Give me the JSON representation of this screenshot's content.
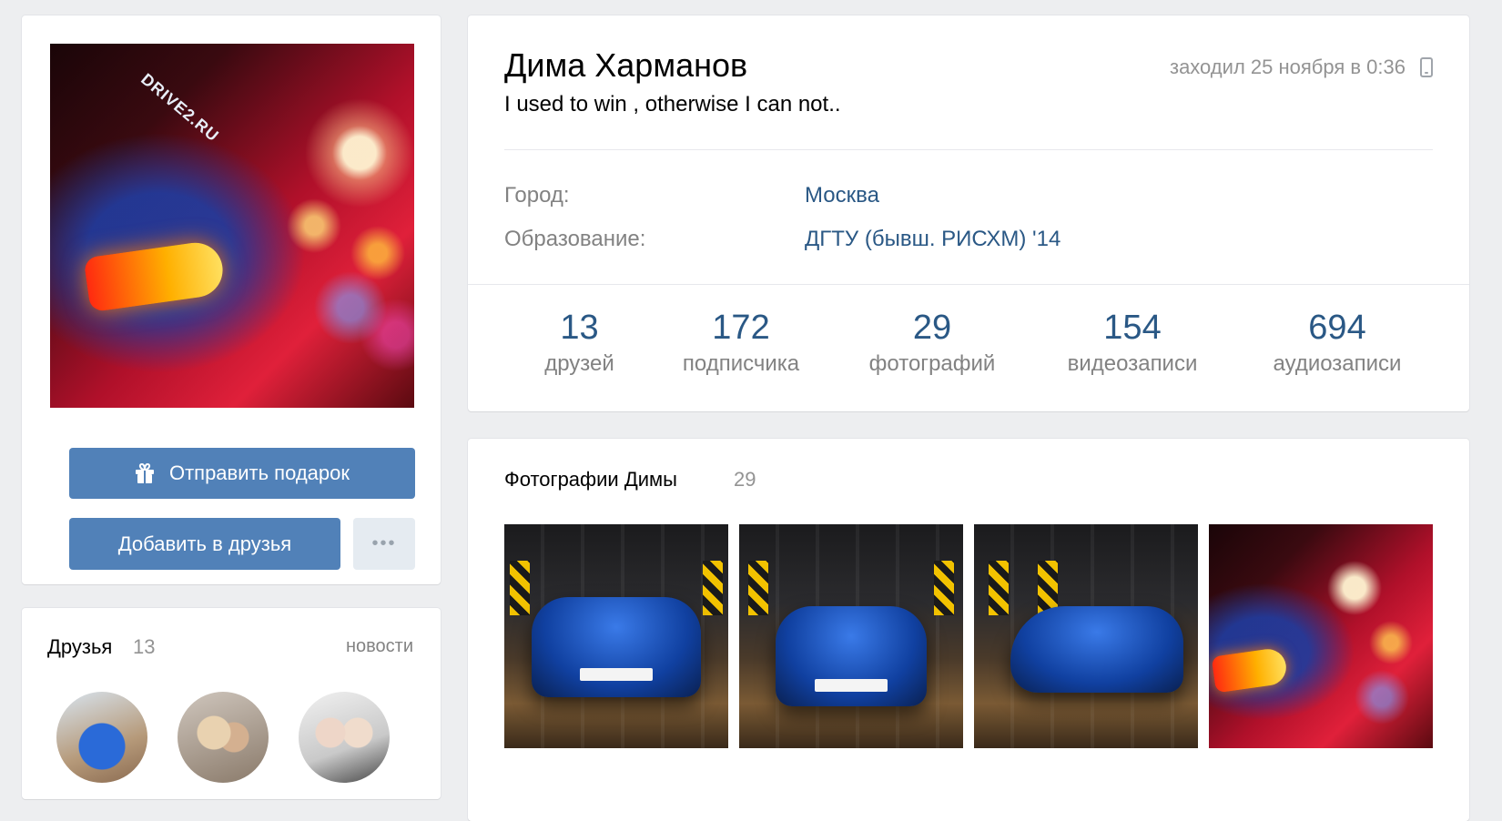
{
  "profile": {
    "name": "Дима Харманов",
    "status": "I used to win , otherwise I can not..",
    "last_seen": "заходил 25 ноября в 0:36",
    "info": {
      "city_label": "Город:",
      "city_value": "Москва",
      "education_label": "Образование:",
      "education_value": "ДГТУ (бывш. РИСХМ) '14"
    },
    "counters": [
      {
        "value": "13",
        "label": "друзей"
      },
      {
        "value": "172",
        "label": "подписчика"
      },
      {
        "value": "29",
        "label": "фотографий"
      },
      {
        "value": "154",
        "label": "видеозаписи"
      },
      {
        "value": "694",
        "label": "аудиозаписи"
      }
    ]
  },
  "avatar": {
    "sticker_text": "DRIVE2.RU"
  },
  "actions": {
    "gift_label": "Отправить подарок",
    "add_friend_label": "Добавить в друзья",
    "more_label": "•••"
  },
  "friends": {
    "title": "Друзья",
    "count": "13",
    "news_label": "новости"
  },
  "photos": {
    "title": "Фотографии Димы",
    "count": "29"
  },
  "icons": {
    "gift": "gift-icon",
    "phone": "mobile-phone-icon",
    "more": "more-dots-icon"
  },
  "colors": {
    "accent": "#5181b8",
    "link": "#2a5885",
    "muted": "#828282",
    "background": "#edeef0"
  }
}
